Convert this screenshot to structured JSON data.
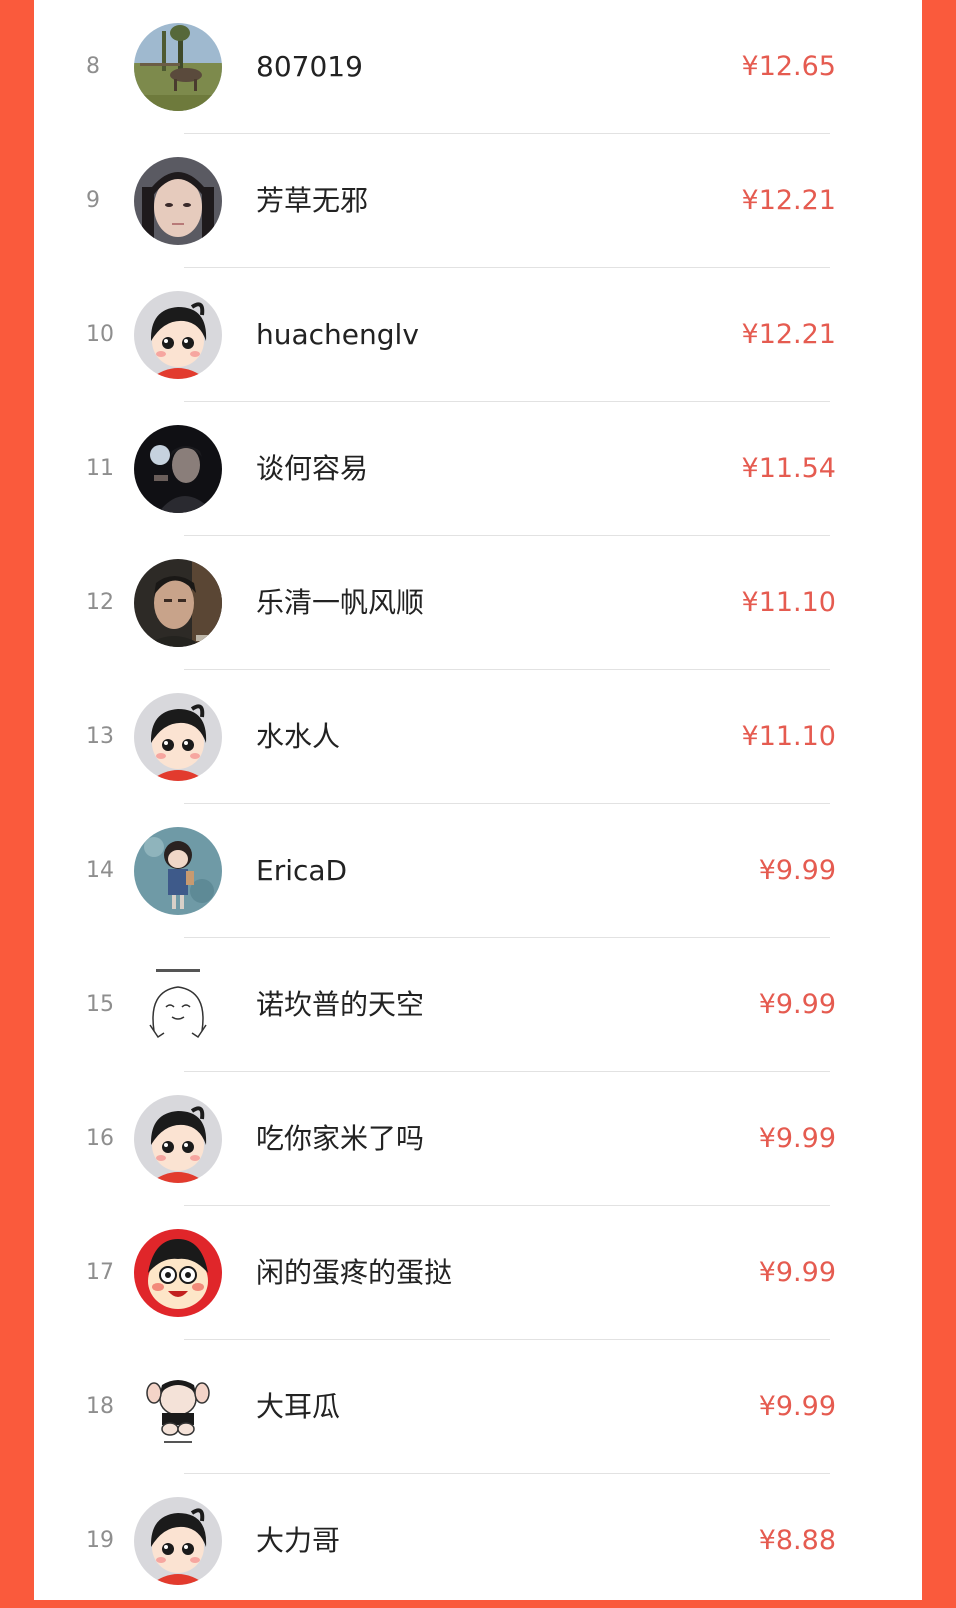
{
  "colors": {
    "background": "#fa5a3c",
    "panel": "#ffffff",
    "amount": "#e55b50",
    "rank": "#8e8e8e",
    "name": "#222222",
    "divider": "#e2e2e2"
  },
  "leaderboard": {
    "rows": [
      {
        "rank": "8",
        "name": "807019",
        "amount": "¥12.65",
        "avatar": "landscape-donkey-photo"
      },
      {
        "rank": "9",
        "name": "芳草无邪",
        "amount": "¥12.21",
        "avatar": "woman-portrait-photo"
      },
      {
        "rank": "10",
        "name": "huachenglv",
        "amount": "¥12.21",
        "avatar": "default-cartoon-avatar"
      },
      {
        "rank": "11",
        "name": "谈何容易",
        "amount": "¥11.54",
        "avatar": "dark-man-photo"
      },
      {
        "rank": "12",
        "name": "乐清一帆风顺",
        "amount": "¥11.10",
        "avatar": "man-portrait-photo"
      },
      {
        "rank": "13",
        "name": "水水人",
        "amount": "¥11.10",
        "avatar": "default-cartoon-avatar"
      },
      {
        "rank": "14",
        "name": "EricaD",
        "amount": "¥9.99",
        "avatar": "girl-illustration"
      },
      {
        "rank": "15",
        "name": "诺坎普的天空",
        "amount": "¥9.99",
        "avatar": "sketch-face-drawing"
      },
      {
        "rank": "16",
        "name": "吃你家米了吗",
        "amount": "¥9.99",
        "avatar": "default-cartoon-avatar"
      },
      {
        "rank": "17",
        "name": "闲的蛋疼的蛋挞",
        "amount": "¥9.99",
        "avatar": "red-cartoon-boy"
      },
      {
        "rank": "18",
        "name": "大耳瓜",
        "amount": "¥9.99",
        "avatar": "cartoon-sticker"
      },
      {
        "rank": "19",
        "name": "大力哥",
        "amount": "¥8.88",
        "avatar": "default-cartoon-avatar"
      }
    ]
  }
}
